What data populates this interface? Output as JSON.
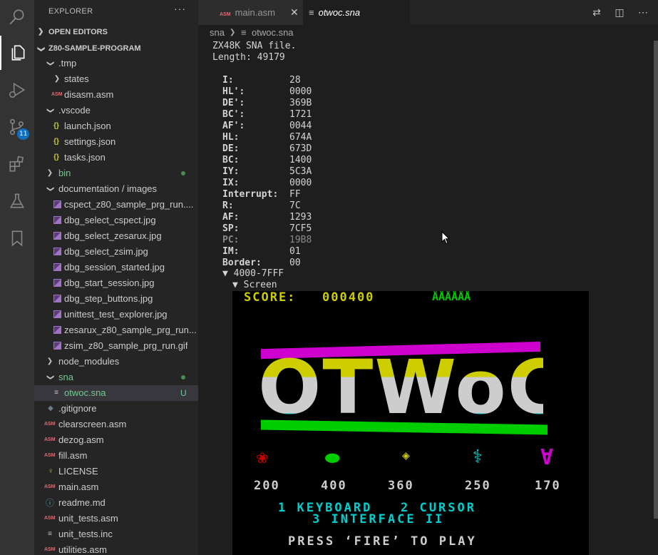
{
  "sidebar": {
    "title": "EXPLORER",
    "more": "···",
    "open_editors": "OPEN EDITORS",
    "project": "Z80-SAMPLE-PROGRAM",
    "tree": [
      {
        "label": "states"
      },
      {
        "label": "disasm.asm"
      },
      {
        "label": ".vscode"
      },
      {
        "label": "launch.json"
      },
      {
        "label": "settings.json"
      },
      {
        "label": "tasks.json"
      },
      {
        "label": "bin"
      },
      {
        "label": "documentation / images"
      },
      {
        "label": "cspect_z80_sample_prg_run...."
      },
      {
        "label": "dbg_select_cspect.jpg"
      },
      {
        "label": "dbg_select_zesarux.jpg"
      },
      {
        "label": "dbg_select_zsim.jpg"
      },
      {
        "label": "dbg_session_started.jpg"
      },
      {
        "label": "dbg_start_session.jpg"
      },
      {
        "label": "dbg_step_buttons.jpg"
      },
      {
        "label": "unittest_test_explorer.jpg"
      },
      {
        "label": "zesarux_z80_sample_prg_run..."
      },
      {
        "label": "zsim_z80_sample_prg_run.gif"
      },
      {
        "label": "node_modules"
      },
      {
        "label": "sna"
      },
      {
        "label": "otwoc.sna",
        "badge": "U"
      },
      {
        "label": ".gitignore"
      },
      {
        "label": "clearscreen.asm"
      },
      {
        "label": "dezog.asm"
      },
      {
        "label": "fill.asm"
      },
      {
        "label": "LICENSE"
      },
      {
        "label": "main.asm"
      },
      {
        "label": "readme.md"
      },
      {
        "label": "unit_tests.asm"
      },
      {
        "label": "unit_tests.inc"
      },
      {
        "label": "utilities.asm"
      }
    ],
    "tmp": ".tmp"
  },
  "activity": {
    "scm_badge": "11"
  },
  "tabs": [
    {
      "label": "main.asm",
      "icon": "ASM"
    },
    {
      "label": "otwoc.sna"
    }
  ],
  "breadcrumb": {
    "folder": "sna",
    "file": "otwoc.sna"
  },
  "editor": {
    "header": [
      "ZX48K SNA file.",
      "Length: 49179"
    ],
    "registers": [
      {
        "name": "I:",
        "value": "28"
      },
      {
        "name": "HL':",
        "value": "0000"
      },
      {
        "name": "DE':",
        "value": "369B"
      },
      {
        "name": "BC':",
        "value": "1721"
      },
      {
        "name": "AF':",
        "value": "0044"
      },
      {
        "name": "HL:",
        "value": "674A"
      },
      {
        "name": "DE:",
        "value": "673D"
      },
      {
        "name": "BC:",
        "value": "1400"
      },
      {
        "name": "IY:",
        "value": "5C3A"
      },
      {
        "name": "IX:",
        "value": "0000"
      },
      {
        "name": "Interrupt:",
        "value": "FF"
      },
      {
        "name": "R:",
        "value": "7C"
      },
      {
        "name": "AF:",
        "value": "1293"
      },
      {
        "name": "SP:",
        "value": "7CF5"
      },
      {
        "name": "PC:",
        "value": "19B8"
      },
      {
        "name": "IM:",
        "value": "01"
      },
      {
        "name": "Border:",
        "value": "00"
      }
    ],
    "bank": "▼ 4000-7FFF",
    "screen_label": "▼ Screen"
  },
  "game": {
    "score_label": "SCORE:",
    "score": "000400",
    "lives": "ÅÅÅÅÅÅ",
    "logo": "OTWoC",
    "points": [
      "200",
      "400",
      "360",
      "250",
      "170"
    ],
    "menu1": "1 KEYBOARD   2 CURSOR",
    "menu2": "3 INTERFACE II",
    "press": "PRESS ‘FIRE’ TO PLAY"
  },
  "colors": {
    "accent": "#0e70c0",
    "git_untracked": "#73c991",
    "spec_yellow": "#cdcd00",
    "spec_green": "#00cd00",
    "spec_cyan": "#00cdcd",
    "spec_magenta": "#cd00cd",
    "spec_red": "#cd0000",
    "spec_white": "#cdcdcd"
  }
}
